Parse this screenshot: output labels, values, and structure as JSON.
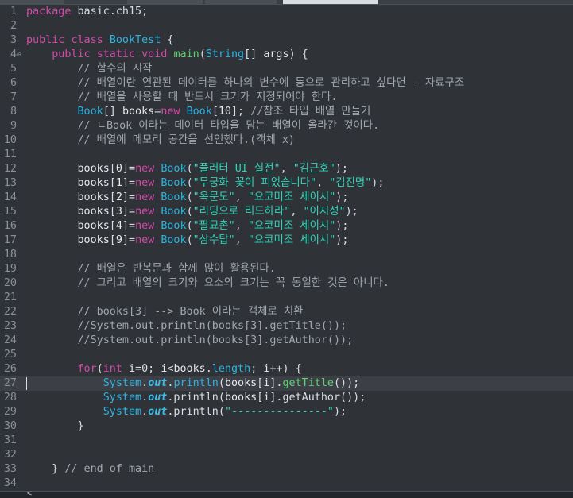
{
  "editor": {
    "fold_marker": "⊖",
    "current_line": 27,
    "lines": [
      {
        "n": "1",
        "tokens": [
          {
            "c": "kw",
            "t": "package"
          },
          {
            "c": "pl",
            "t": " basic.ch15;"
          }
        ]
      },
      {
        "n": "2",
        "tokens": []
      },
      {
        "n": "3",
        "tokens": [
          {
            "c": "kw",
            "t": "public"
          },
          {
            "c": "pl",
            "t": " "
          },
          {
            "c": "kw",
            "t": "class"
          },
          {
            "c": "pl",
            "t": " "
          },
          {
            "c": "ty",
            "t": "BookTest"
          },
          {
            "c": "pl",
            "t": " {"
          }
        ]
      },
      {
        "n": "4",
        "fold": true,
        "tokens": [
          {
            "c": "pl",
            "t": "    "
          },
          {
            "c": "kw",
            "t": "public"
          },
          {
            "c": "pl",
            "t": " "
          },
          {
            "c": "kw",
            "t": "static"
          },
          {
            "c": "pl",
            "t": " "
          },
          {
            "c": "kw",
            "t": "void"
          },
          {
            "c": "pl",
            "t": " "
          },
          {
            "c": "fn",
            "t": "main"
          },
          {
            "c": "pl",
            "t": "("
          },
          {
            "c": "ty",
            "t": "String"
          },
          {
            "c": "pl",
            "t": "[] "
          },
          {
            "c": "var",
            "t": "args"
          },
          {
            "c": "pl",
            "t": ") {"
          }
        ]
      },
      {
        "n": "5",
        "tokens": [
          {
            "c": "cm",
            "t": "        // 함수의 시작"
          }
        ]
      },
      {
        "n": "6",
        "tokens": [
          {
            "c": "cm",
            "t": "        // 배열이란 연관된 데이터를 하나의 변수에 통으로 관리하고 싶다면 - 자료구조"
          }
        ]
      },
      {
        "n": "7",
        "tokens": [
          {
            "c": "cm",
            "t": "        // 배열을 사용할 때 반드시 크기가 지정되어야 한다."
          }
        ]
      },
      {
        "n": "8",
        "tokens": [
          {
            "c": "pl",
            "t": "        "
          },
          {
            "c": "ty",
            "t": "Book"
          },
          {
            "c": "pl",
            "t": "[] "
          },
          {
            "c": "var",
            "t": "books"
          },
          {
            "c": "pl",
            "t": "="
          },
          {
            "c": "kw",
            "t": "new"
          },
          {
            "c": "pl",
            "t": " "
          },
          {
            "c": "ty",
            "t": "Book"
          },
          {
            "c": "pl",
            "t": "["
          },
          {
            "c": "num",
            "t": "10"
          },
          {
            "c": "pl",
            "t": "]; "
          },
          {
            "c": "cm",
            "t": "//참조 타입 배열 만들기"
          }
        ]
      },
      {
        "n": "9",
        "tokens": [
          {
            "c": "cm",
            "t": "        // ㄴBook 이라는 데이터 타입을 담는 배열이 올라간 것이다."
          }
        ]
      },
      {
        "n": "10",
        "tokens": [
          {
            "c": "cm",
            "t": "        // 배열에 메모리 공간을 선언했다.(객체 x)"
          }
        ]
      },
      {
        "n": "11",
        "tokens": []
      },
      {
        "n": "12",
        "tokens": [
          {
            "c": "pl",
            "t": "        "
          },
          {
            "c": "var",
            "t": "books"
          },
          {
            "c": "pl",
            "t": "["
          },
          {
            "c": "num",
            "t": "0"
          },
          {
            "c": "pl",
            "t": "]="
          },
          {
            "c": "kw",
            "t": "new"
          },
          {
            "c": "pl",
            "t": " "
          },
          {
            "c": "ty",
            "t": "Book"
          },
          {
            "c": "pl",
            "t": "("
          },
          {
            "c": "st",
            "t": "\"플러터 UI 실전\""
          },
          {
            "c": "pl",
            "t": ", "
          },
          {
            "c": "st",
            "t": "\"김근호\""
          },
          {
            "c": "pl",
            "t": ");"
          }
        ]
      },
      {
        "n": "13",
        "tokens": [
          {
            "c": "pl",
            "t": "        "
          },
          {
            "c": "var",
            "t": "books"
          },
          {
            "c": "pl",
            "t": "["
          },
          {
            "c": "num",
            "t": "1"
          },
          {
            "c": "pl",
            "t": "]="
          },
          {
            "c": "kw",
            "t": "new"
          },
          {
            "c": "pl",
            "t": " "
          },
          {
            "c": "ty",
            "t": "Book"
          },
          {
            "c": "pl",
            "t": "("
          },
          {
            "c": "st",
            "t": "\"무궁화 꽃이 피었습니다\""
          },
          {
            "c": "pl",
            "t": ", "
          },
          {
            "c": "st",
            "t": "\"김진명\""
          },
          {
            "c": "pl",
            "t": ");"
          }
        ]
      },
      {
        "n": "14",
        "tokens": [
          {
            "c": "pl",
            "t": "        "
          },
          {
            "c": "var",
            "t": "books"
          },
          {
            "c": "pl",
            "t": "["
          },
          {
            "c": "num",
            "t": "2"
          },
          {
            "c": "pl",
            "t": "]="
          },
          {
            "c": "kw",
            "t": "new"
          },
          {
            "c": "pl",
            "t": " "
          },
          {
            "c": "ty",
            "t": "Book"
          },
          {
            "c": "pl",
            "t": "("
          },
          {
            "c": "st",
            "t": "\"옥문도\""
          },
          {
            "c": "pl",
            "t": ", "
          },
          {
            "c": "st",
            "t": "\"요코미조 세이시\""
          },
          {
            "c": "pl",
            "t": ");"
          }
        ]
      },
      {
        "n": "15",
        "tokens": [
          {
            "c": "pl",
            "t": "        "
          },
          {
            "c": "var",
            "t": "books"
          },
          {
            "c": "pl",
            "t": "["
          },
          {
            "c": "num",
            "t": "3"
          },
          {
            "c": "pl",
            "t": "]="
          },
          {
            "c": "kw",
            "t": "new"
          },
          {
            "c": "pl",
            "t": " "
          },
          {
            "c": "ty",
            "t": "Book"
          },
          {
            "c": "pl",
            "t": "("
          },
          {
            "c": "st",
            "t": "\"리딩으로 리드하라\""
          },
          {
            "c": "pl",
            "t": ", "
          },
          {
            "c": "st",
            "t": "\"이지성\""
          },
          {
            "c": "pl",
            "t": ");"
          }
        ]
      },
      {
        "n": "16",
        "tokens": [
          {
            "c": "pl",
            "t": "        "
          },
          {
            "c": "var",
            "t": "books"
          },
          {
            "c": "pl",
            "t": "["
          },
          {
            "c": "num",
            "t": "4"
          },
          {
            "c": "pl",
            "t": "]="
          },
          {
            "c": "kw",
            "t": "new"
          },
          {
            "c": "pl",
            "t": " "
          },
          {
            "c": "ty",
            "t": "Book"
          },
          {
            "c": "pl",
            "t": "("
          },
          {
            "c": "st",
            "t": "\"팔묘촌\""
          },
          {
            "c": "pl",
            "t": ", "
          },
          {
            "c": "st",
            "t": "\"요코미조 세이시\""
          },
          {
            "c": "pl",
            "t": ");"
          }
        ]
      },
      {
        "n": "17",
        "tokens": [
          {
            "c": "pl",
            "t": "        "
          },
          {
            "c": "var",
            "t": "books"
          },
          {
            "c": "pl",
            "t": "["
          },
          {
            "c": "num",
            "t": "9"
          },
          {
            "c": "pl",
            "t": "]="
          },
          {
            "c": "kw",
            "t": "new"
          },
          {
            "c": "pl",
            "t": " "
          },
          {
            "c": "ty",
            "t": "Book"
          },
          {
            "c": "pl",
            "t": "("
          },
          {
            "c": "st",
            "t": "\"삼수탑\""
          },
          {
            "c": "pl",
            "t": ", "
          },
          {
            "c": "st",
            "t": "\"요코미조 세이시\""
          },
          {
            "c": "pl",
            "t": ");"
          }
        ]
      },
      {
        "n": "18",
        "tokens": []
      },
      {
        "n": "19",
        "tokens": [
          {
            "c": "cm",
            "t": "        // 배열은 반복문과 함께 많이 활용된다."
          }
        ]
      },
      {
        "n": "20",
        "tokens": [
          {
            "c": "cm",
            "t": "        // 그리고 배열의 크기와 요소의 크기는 꼭 동일한 것은 아니다."
          }
        ]
      },
      {
        "n": "21",
        "tokens": []
      },
      {
        "n": "22",
        "tokens": [
          {
            "c": "cm",
            "t": "        // books[3] --> Book 이라는 객체로 치환"
          }
        ]
      },
      {
        "n": "23",
        "tokens": [
          {
            "c": "cm",
            "t": "        //System.out.println(books[3].getTitle());"
          }
        ]
      },
      {
        "n": "24",
        "tokens": [
          {
            "c": "cm",
            "t": "        //System.out.println(books[3].getAuthor());"
          }
        ]
      },
      {
        "n": "25",
        "tokens": []
      },
      {
        "n": "26",
        "tokens": [
          {
            "c": "pl",
            "t": "        "
          },
          {
            "c": "kw",
            "t": "for"
          },
          {
            "c": "pl",
            "t": "("
          },
          {
            "c": "kw",
            "t": "int"
          },
          {
            "c": "pl",
            "t": " "
          },
          {
            "c": "var",
            "t": "i"
          },
          {
            "c": "pl",
            "t": "=0; "
          },
          {
            "c": "var",
            "t": "i"
          },
          {
            "c": "pl",
            "t": "<"
          },
          {
            "c": "var",
            "t": "books"
          },
          {
            "c": "pl",
            "t": "."
          },
          {
            "c": "ty",
            "t": "length"
          },
          {
            "c": "pl",
            "t": "; "
          },
          {
            "c": "var",
            "t": "i"
          },
          {
            "c": "pl",
            "t": "++) {"
          }
        ]
      },
      {
        "n": "27",
        "tokens": [
          {
            "c": "pl",
            "t": "            "
          },
          {
            "c": "ty",
            "t": "System"
          },
          {
            "c": "pl",
            "t": "."
          },
          {
            "c": "fld",
            "t": "out"
          },
          {
            "c": "pl",
            "t": "."
          },
          {
            "c": "ty",
            "t": "println"
          },
          {
            "c": "pl",
            "t": "("
          },
          {
            "c": "var",
            "t": "books"
          },
          {
            "c": "pl",
            "t": "["
          },
          {
            "c": "var",
            "t": "i"
          },
          {
            "c": "pl",
            "t": "]."
          },
          {
            "c": "fn",
            "t": "getTitle"
          },
          {
            "c": "pl",
            "t": "());"
          }
        ]
      },
      {
        "n": "28",
        "tokens": [
          {
            "c": "pl",
            "t": "            "
          },
          {
            "c": "ty",
            "t": "System"
          },
          {
            "c": "pl",
            "t": "."
          },
          {
            "c": "fld",
            "t": "out"
          },
          {
            "c": "pl",
            "t": ".println("
          },
          {
            "c": "var",
            "t": "books"
          },
          {
            "c": "pl",
            "t": "["
          },
          {
            "c": "var",
            "t": "i"
          },
          {
            "c": "pl",
            "t": "].getAuthor());"
          }
        ]
      },
      {
        "n": "29",
        "tokens": [
          {
            "c": "pl",
            "t": "            "
          },
          {
            "c": "ty",
            "t": "System"
          },
          {
            "c": "pl",
            "t": "."
          },
          {
            "c": "fld",
            "t": "out"
          },
          {
            "c": "pl",
            "t": ".println("
          },
          {
            "c": "st",
            "t": "\"---------------\""
          },
          {
            "c": "pl",
            "t": ");"
          }
        ]
      },
      {
        "n": "30",
        "tokens": [
          {
            "c": "pl",
            "t": "        }"
          }
        ]
      },
      {
        "n": "31",
        "tokens": []
      },
      {
        "n": "32",
        "tokens": []
      },
      {
        "n": "33",
        "tokens": [
          {
            "c": "pl",
            "t": "    } "
          },
          {
            "c": "cm",
            "t": "// end of main"
          }
        ]
      },
      {
        "n": "34",
        "tokens": []
      }
    ]
  },
  "scrollbar": {
    "arrow": "<"
  },
  "colors": {
    "background": "#2f3338",
    "keyword": "#d44aa8",
    "type": "#2db3e0",
    "string": "#2fd3b7",
    "comment": "#a2a8ae",
    "method": "#5dd06f",
    "current_line": "#3c4046"
  }
}
